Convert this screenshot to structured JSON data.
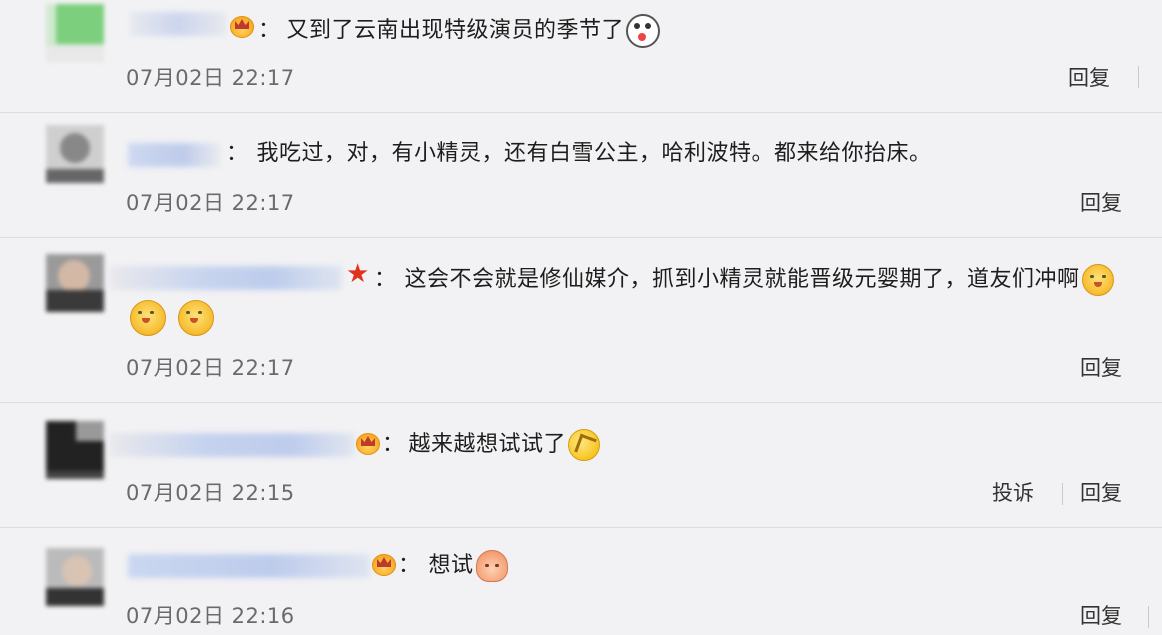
{
  "comments": [
    {
      "badge": "crown",
      "text": "又到了云南出现特级演员的季节了",
      "emoji": "shocked-face",
      "time": "07月02日 22:17",
      "actions": [
        "回复"
      ]
    },
    {
      "badge": "",
      "text": "我吃过，对，有小精灵，还有白雪公主，哈利波特。都来给你抬床。",
      "emoji": "",
      "time": "07月02日 22:17",
      "actions": [
        "回复"
      ]
    },
    {
      "badge": "star",
      "text": "这会不会就是修仙媒介，抓到小精灵就能晋级元婴期了，道友们冲啊",
      "emoji": "doge-face",
      "extra_emojis": [
        "doge-face",
        "doge-face"
      ],
      "time": "07月02日 22:17",
      "actions": [
        "回复"
      ]
    },
    {
      "badge": "crown",
      "text": "越来越想试试了",
      "emoji": "waving-hand-face",
      "time": "07月02日 22:15",
      "actions": [
        "投诉",
        "回复"
      ]
    },
    {
      "badge": "crown",
      "text": "想试",
      "emoji": "bun-face",
      "time": "07月02日 22:16",
      "actions": [
        "回复"
      ]
    }
  ],
  "colon": "："
}
